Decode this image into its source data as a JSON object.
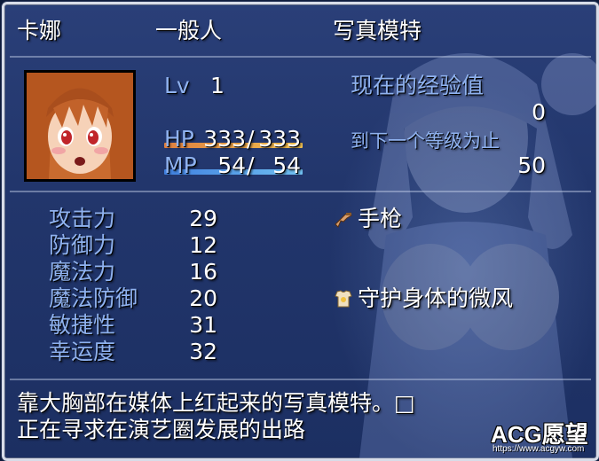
{
  "actor": {
    "name": "卡娜",
    "class": "一般人",
    "nickname": "写真模特",
    "level_label": "Lv",
    "level": "1",
    "hp_label": "HP",
    "hp_current": "333",
    "hp_max": "333",
    "hp_sep": "/",
    "hp_fraction": 1.0,
    "mp_label": "MP",
    "mp_current": "54",
    "mp_max": "54",
    "mp_sep": "/",
    "mp_fraction": 1.0
  },
  "exp": {
    "current_label": "现在的经验值",
    "current_value": "0",
    "next_label": "到下一个等级为止",
    "next_value": "50"
  },
  "params": [
    {
      "label": "攻击力",
      "value": "29"
    },
    {
      "label": "防御力",
      "value": "12"
    },
    {
      "label": "魔法力",
      "value": "16"
    },
    {
      "label": "魔法防御",
      "value": "20"
    },
    {
      "label": "敏捷性",
      "value": "31"
    },
    {
      "label": "幸运度",
      "value": "32"
    }
  ],
  "equipment": [
    {
      "name": "手枪",
      "icon": "gun-icon"
    },
    {
      "name": "守护身体的微风",
      "icon": "armor-icon"
    }
  ],
  "profile": {
    "line1": "靠大胸部在媒体上红起来的写真模特。□",
    "line2": "正在寻求在演艺圈发展的出路"
  },
  "watermark": {
    "logo": "ACG愿望",
    "url": "https://www.acgyw.com"
  },
  "colors": {
    "system_text": "#8fb2ef",
    "hp_gauge_start": "#e08040",
    "hp_gauge_end": "#f0c050",
    "mp_gauge_start": "#4080e0",
    "mp_gauge_end": "#70c0f0"
  }
}
